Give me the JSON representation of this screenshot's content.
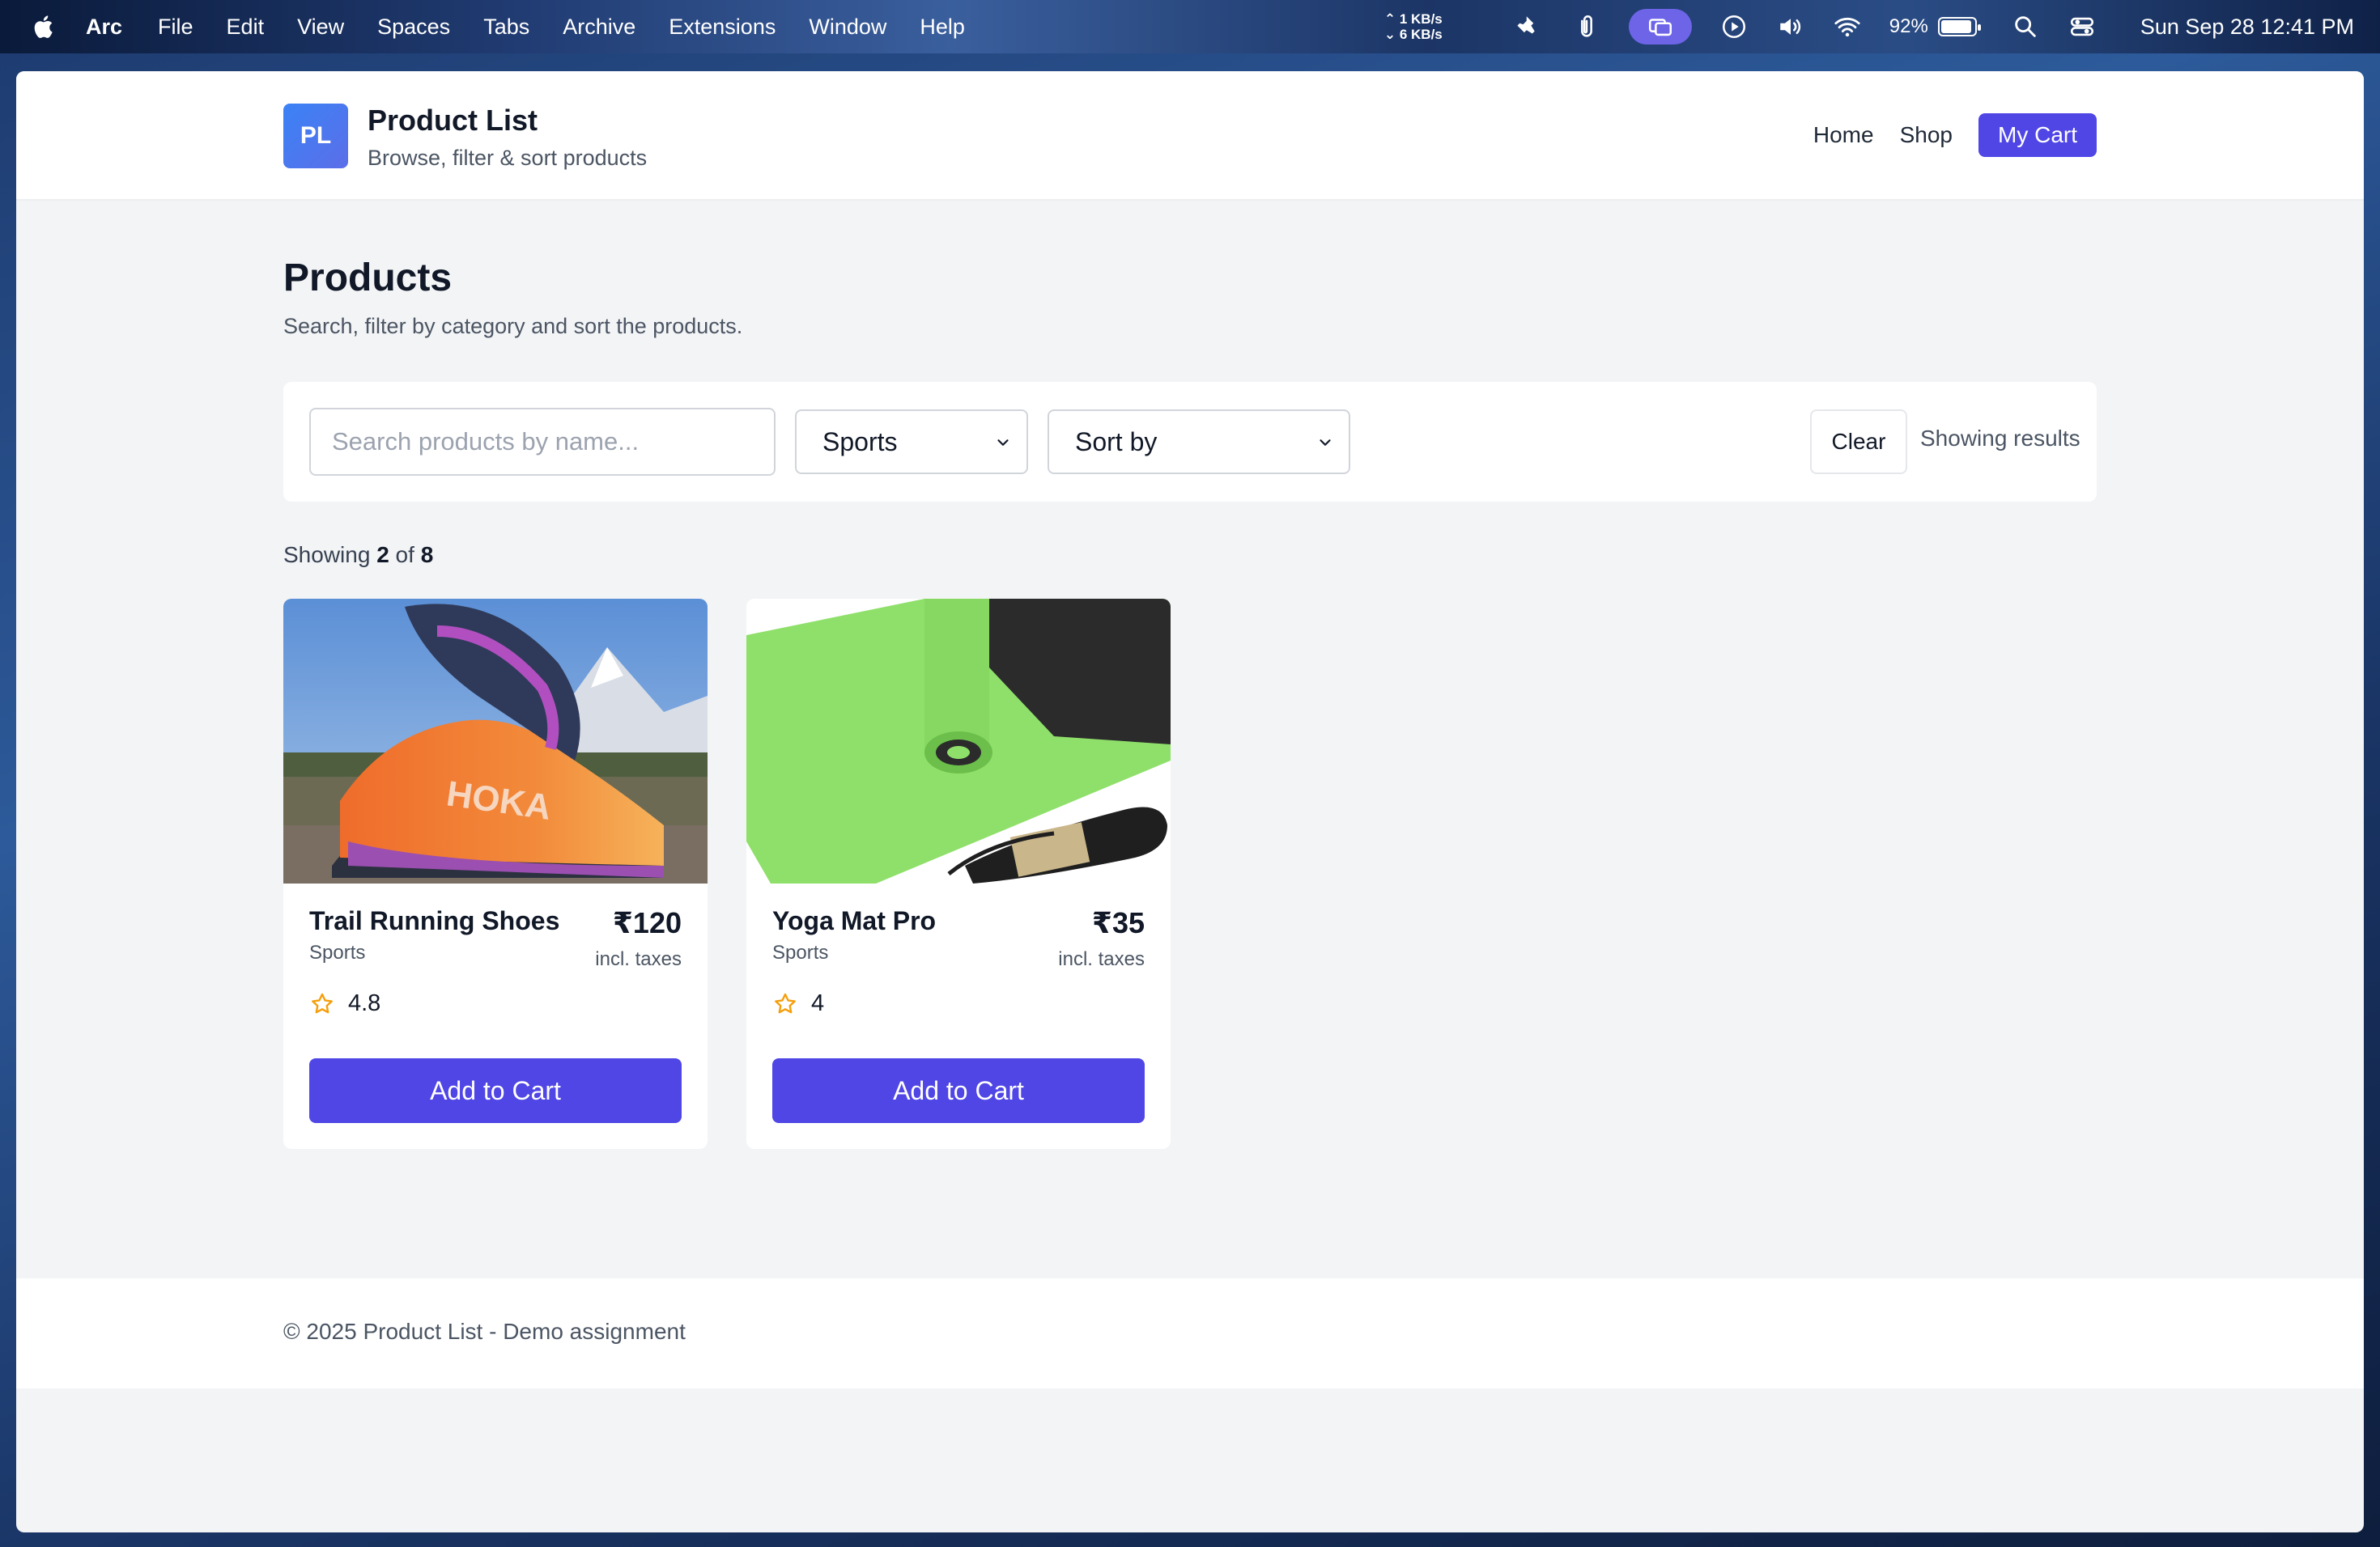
{
  "menubar": {
    "app_name": "Arc",
    "items": [
      "File",
      "Edit",
      "View",
      "Spaces",
      "Tabs",
      "Archive",
      "Extensions",
      "Window",
      "Help"
    ],
    "net_up": "1 KB/s",
    "net_down": "6 KB/s",
    "battery_percent": "92%",
    "battery_level": 0.92,
    "clock": "Sun Sep 28  12:41 PM"
  },
  "header": {
    "logo_text": "PL",
    "title": "Product List",
    "subtitle": "Browse, filter & sort products",
    "nav": {
      "home": "Home",
      "shop": "Shop",
      "cart": "My Cart"
    }
  },
  "page": {
    "title": "Products",
    "subtitle": "Search, filter by category and sort the products."
  },
  "filters": {
    "search_placeholder": "Search products by name...",
    "search_value": "",
    "category_selected": "Sports",
    "sort_selected": "Sort by",
    "clear_label": "Clear",
    "status": "Showing results"
  },
  "results": {
    "prefix": "Showing",
    "shown": "2",
    "of": "of",
    "total": "8"
  },
  "products": [
    {
      "name": "Trail Running Shoes",
      "category": "Sports",
      "price": "₹120",
      "tax_note": "incl. taxes",
      "rating": "4.8",
      "cta": "Add to Cart",
      "image": "trail-running-shoe"
    },
    {
      "name": "Yoga Mat Pro",
      "category": "Sports",
      "price": "₹35",
      "tax_note": "incl. taxes",
      "rating": "4",
      "cta": "Add to Cart",
      "image": "yoga-mat"
    }
  ],
  "footer": {
    "text": "© 2025 Product List - Demo assignment"
  },
  "colors": {
    "accent": "#4f46e5",
    "star": "#f59e0b",
    "page_bg": "#f3f4f6"
  }
}
